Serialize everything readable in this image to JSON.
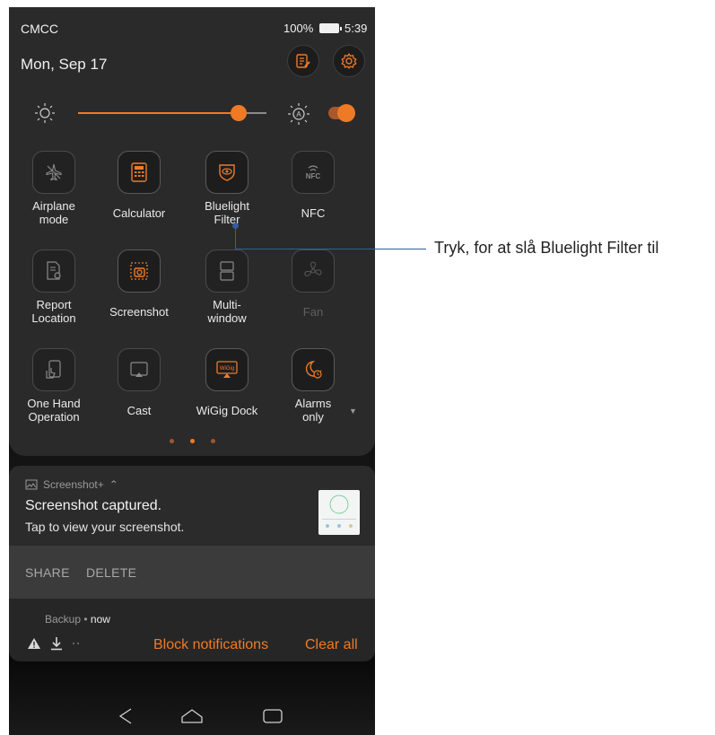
{
  "status_bar": {
    "carrier": "CMCC",
    "battery_percent": "100%",
    "time": "5:39"
  },
  "header": {
    "date": "Mon, Sep 17"
  },
  "brightness": {
    "level": 0.85,
    "auto_enabled": true
  },
  "tiles": [
    {
      "label": "Airplane\nmode",
      "icon": "airplane-icon",
      "state": "off"
    },
    {
      "label": "Calculator",
      "icon": "calculator-icon",
      "state": "on"
    },
    {
      "label": "Bluelight\nFilter",
      "icon": "eye-shield-icon",
      "state": "on"
    },
    {
      "label": "NFC",
      "icon": "nfc-icon",
      "state": "off"
    },
    {
      "label": "Report\nLocation",
      "icon": "report-location-icon",
      "state": "off"
    },
    {
      "label": "Screenshot",
      "icon": "screenshot-icon",
      "state": "on"
    },
    {
      "label": "Multi-\nwindow",
      "icon": "multi-window-icon",
      "state": "off"
    },
    {
      "label": "Fan",
      "icon": "fan-icon",
      "state": "disabled"
    },
    {
      "label": "One Hand\nOperation",
      "icon": "one-hand-icon",
      "state": "off"
    },
    {
      "label": "Cast",
      "icon": "cast-icon",
      "state": "off"
    },
    {
      "label": "WiGig Dock",
      "icon": "wigig-dock-icon",
      "state": "on"
    },
    {
      "label": "Alarms\nonly",
      "icon": "alarms-only-icon",
      "state": "on"
    }
  ],
  "pager": {
    "pages": 3,
    "current": 2
  },
  "notification": {
    "app": "Screenshot+",
    "title": "Screenshot captured.",
    "text": "Tap to view your screenshot.",
    "actions": {
      "share": "SHARE",
      "delete": "DELETE"
    }
  },
  "notification2": {
    "app": "Backup",
    "separator": " • ",
    "time": "now",
    "block_label": "Block notifications",
    "clear_label": "Clear all"
  },
  "callout": {
    "text": "Tryk, for at slå Bluelight Filter til"
  },
  "colors": {
    "accent": "#ef7a26",
    "panel": "#2a2a2a",
    "callout": "#2d5fa6"
  }
}
